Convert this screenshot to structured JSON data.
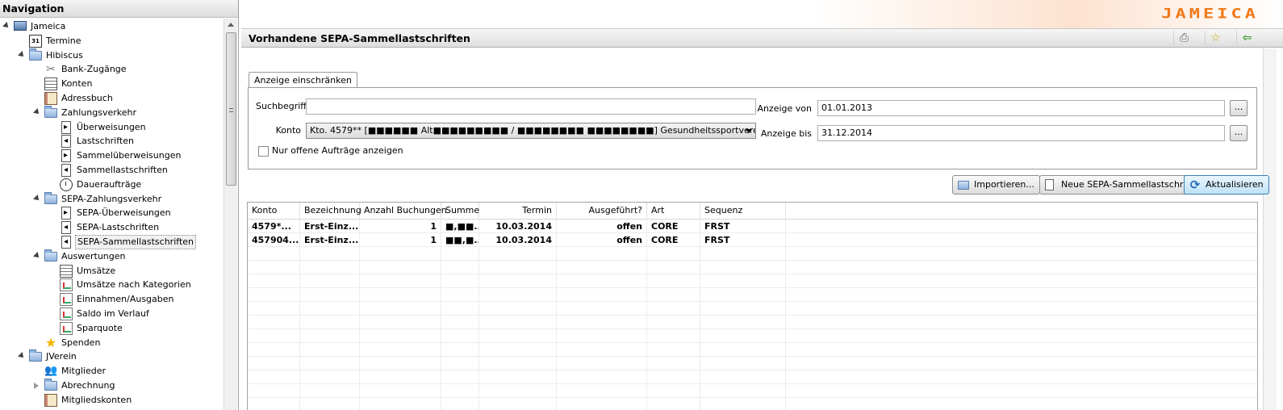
{
  "nav": {
    "title": "Navigation",
    "items": [
      {
        "label": "Jameica",
        "icon": "computer-icon",
        "level": 0,
        "twisty": "open"
      },
      {
        "label": "Termine",
        "icon": "calendar-icon",
        "level": 1,
        "twisty": "none"
      },
      {
        "label": "Hibiscus",
        "icon": "folder-icon",
        "level": 1,
        "twisty": "open"
      },
      {
        "label": "Bank-Zugänge",
        "icon": "tools-icon",
        "level": 2,
        "twisty": "none"
      },
      {
        "label": "Konten",
        "icon": "list-icon",
        "level": 2,
        "twisty": "none"
      },
      {
        "label": "Adressbuch",
        "icon": "book-icon",
        "level": 2,
        "twisty": "none"
      },
      {
        "label": "Zahlungsverkehr",
        "icon": "folder-icon",
        "level": 2,
        "twisty": "open"
      },
      {
        "label": "Überweisungen",
        "icon": "document-right-icon",
        "level": 3,
        "twisty": "none"
      },
      {
        "label": "Lastschriften",
        "icon": "document-left-icon",
        "level": 3,
        "twisty": "none"
      },
      {
        "label": "Sammelüberweisungen",
        "icon": "document-right-icon",
        "level": 3,
        "twisty": "none"
      },
      {
        "label": "Sammellastschriften",
        "icon": "document-left-icon",
        "level": 3,
        "twisty": "none"
      },
      {
        "label": "Daueraufträge",
        "icon": "clock-icon",
        "level": 3,
        "twisty": "none"
      },
      {
        "label": "SEPA-Zahlungsverkehr",
        "icon": "folder-icon",
        "level": 2,
        "twisty": "open"
      },
      {
        "label": "SEPA-Überweisungen",
        "icon": "document-right-icon",
        "level": 3,
        "twisty": "none"
      },
      {
        "label": "SEPA-Lastschriften",
        "icon": "document-left-icon",
        "level": 3,
        "twisty": "none"
      },
      {
        "label": "SEPA-Sammellastschriften",
        "icon": "document-left-icon",
        "level": 3,
        "twisty": "none",
        "selected": true
      },
      {
        "label": "Auswertungen",
        "icon": "folder-icon",
        "level": 2,
        "twisty": "open"
      },
      {
        "label": "Umsätze",
        "icon": "list-icon",
        "level": 3,
        "twisty": "none"
      },
      {
        "label": "Umsätze nach Kategorien",
        "icon": "chart-icon",
        "level": 3,
        "twisty": "none"
      },
      {
        "label": "Einnahmen/Ausgaben",
        "icon": "chart-icon",
        "level": 3,
        "twisty": "none"
      },
      {
        "label": "Saldo im Verlauf",
        "icon": "chart-icon",
        "level": 3,
        "twisty": "none"
      },
      {
        "label": "Sparquote",
        "icon": "chart-icon",
        "level": 3,
        "twisty": "none"
      },
      {
        "label": "Spenden",
        "icon": "star-icon",
        "level": 2,
        "twisty": "none"
      },
      {
        "label": "JVerein",
        "icon": "folder-icon",
        "level": 1,
        "twisty": "open"
      },
      {
        "label": "Mitglieder",
        "icon": "people-icon",
        "level": 2,
        "twisty": "none"
      },
      {
        "label": "Abrechnung",
        "icon": "folder-icon",
        "level": 2,
        "twisty": "closed"
      },
      {
        "label": "Mitgliedskonten",
        "icon": "book-icon",
        "level": 2,
        "twisty": "none"
      }
    ]
  },
  "app": {
    "logo": "JAMEICA"
  },
  "view": {
    "title": "Vorhandene SEPA-Sammellastschriften",
    "toolbar_icons": [
      "print-icon",
      "bookmark-star-icon",
      "back-arrow-icon"
    ]
  },
  "filter": {
    "tab_label": "Anzeige einschränken",
    "search_label": "Suchbegriff",
    "search_value": "",
    "konto_label": "Konto",
    "konto_value": "Kto. 4579** [■■■■■■ Alt■■■■■■■■■ / ■■■■■■■■ ■■■■■■■■] Gesundheitssportverein BS - Gesundheitssportve",
    "open_only_label": "Nur offene Aufträge anzeigen",
    "open_only_checked": false,
    "from_label": "Anzeige von",
    "from_value": "01.01.2013",
    "to_label": "Anzeige bis",
    "to_value": "31.12.2014",
    "picker_label": "..."
  },
  "actions": {
    "import_label": "Importieren...",
    "new_label": "Neue SEPA-Sammellastschrift",
    "refresh_label": "Aktualisieren"
  },
  "table": {
    "columns": [
      "Konto",
      "Bezeichnung",
      "Anzahl Buchungen",
      "Summe",
      "Termin",
      "Ausgeführt?",
      "Art",
      "Sequenz"
    ],
    "rows": [
      {
        "konto": "4579*...",
        "bezeichnung": "Erst-Einz...",
        "anzahl": "1",
        "summe": "■,■■...",
        "termin": "10.03.2014",
        "ausgefuehrt": "offen",
        "art": "CORE",
        "sequenz": "FRST"
      },
      {
        "konto": "457904...",
        "bezeichnung": "Erst-Einz...",
        "anzahl": "1",
        "summe": "■■,■...",
        "termin": "10.03.2014",
        "ausgefuehrt": "offen",
        "art": "CORE",
        "sequenz": "FRST"
      }
    ]
  }
}
